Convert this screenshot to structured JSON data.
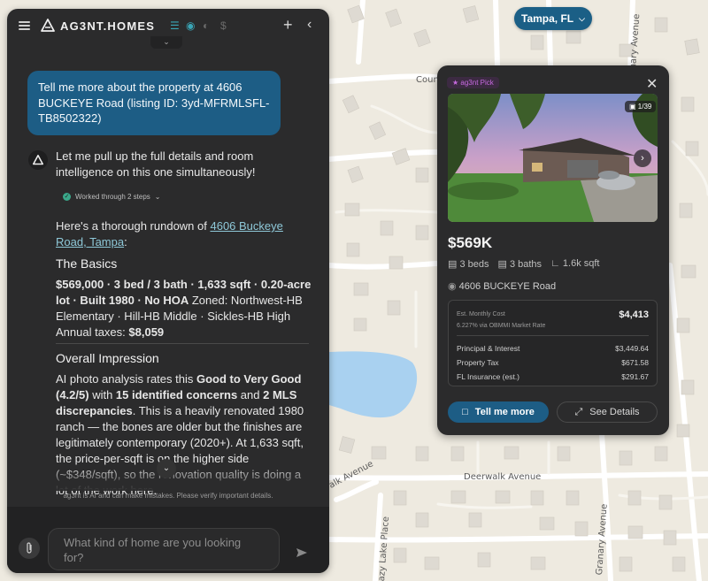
{
  "map": {
    "city_selector": "Tampa, FL",
    "streets": [
      "Count",
      "Deerwalk Avenue",
      "alk Avenue",
      "Granary Avenue",
      "azy Lake Place",
      "nary Avenue"
    ]
  },
  "chat": {
    "brand": "AG3NT.HOMES",
    "user_message": "Tell me more about the property at 4606 BUCKEYE Road (listing ID: 3yd-MFRMLSFL-TB8502322)",
    "assistant_intro": "Let me pull up the full details and room intelligence on this one simultaneously!",
    "steps_label": "Worked through 2 steps",
    "rundown_prefix": "Here's a thorough rundown of ",
    "rundown_link": "4606 Buckeye Road, Tampa",
    "rundown_suffix": ":",
    "basics_heading": "The Basics",
    "basics_bold": "$569,000 · 3 bed / 3 bath · 1,633 sqft · 0.20-acre lot · Built 1980 · No HOA",
    "basics_rest": " Zoned: Northwest-HB Elementary · Hill-HB Middle · Sickles-HB High",
    "taxes_label": "Annual taxes: ",
    "taxes_value": "$8,059",
    "impression_heading": "Overall Impression",
    "impression_p1": "AI photo analysis rates this ",
    "impression_b1": "Good to Very Good (4.2/5)",
    "impression_p2": " with ",
    "impression_b2": "15 identified concerns",
    "impression_p3": " and ",
    "impression_b3": "2 MLS discrepancies",
    "impression_p4": ". This is a heavily renovated 1980 ranch — the bones are older but the finishes are legitimately contemporary (2020+). At 1,633 sqft, the price-per-sqft is on the higher side (~$348/sqft), so the renovation quality is doing a lot of the work here.",
    "disclaimer": "ag3nt is AI and can make mistakes. Please verify important details.",
    "input_placeholder": "What kind of home are you looking for?"
  },
  "card": {
    "badge": "ag3nt Pick",
    "photo_counter": "1/39",
    "price": "$569K",
    "beds": "3 beds",
    "baths": "3 baths",
    "sqft": "1.6k sqft",
    "address": "4606 BUCKEYE Road",
    "est_label": "Est. Monthly Cost",
    "est_sub": "6.227% via OBMMI Market Rate",
    "est_value": "$4,413",
    "rows": [
      {
        "label": "Principal & Interest",
        "value": "$3,449.64"
      },
      {
        "label": "Property Tax",
        "value": "$671.58"
      },
      {
        "label": "FL Insurance (est.)",
        "value": "$291.67"
      }
    ],
    "primary_button": "Tell me more",
    "secondary_button": "See Details"
  },
  "colors": {
    "accent": "#1d5d85",
    "panel": "#2b2b2c",
    "badge_purple": "#c76ae0",
    "check_green": "#3aa88a"
  }
}
